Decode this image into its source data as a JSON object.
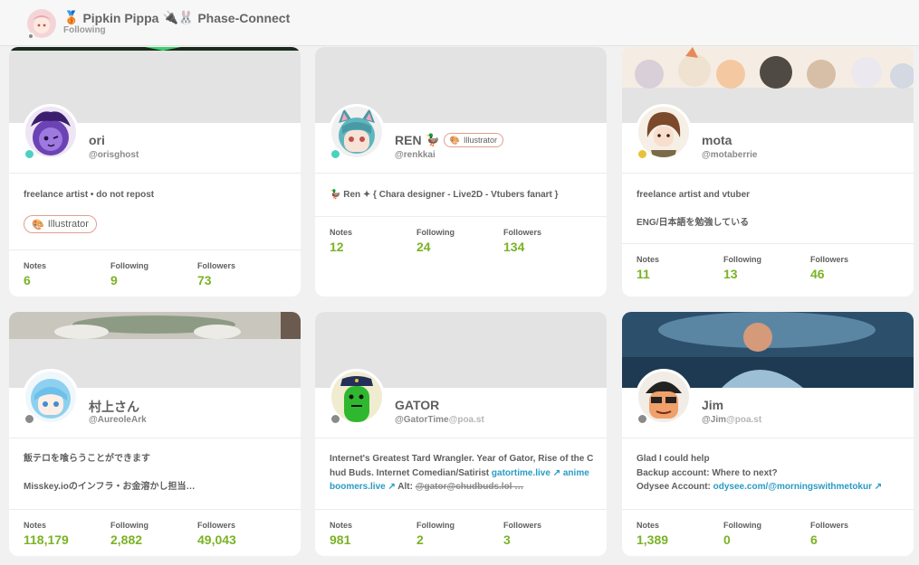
{
  "header": {
    "medal_emoji": "🥉",
    "title": "Pipkin Pippa",
    "title_emojis": "🔌🐰",
    "org": "Phase-Connect",
    "subtitle": "Following"
  },
  "stat_labels": {
    "notes": "Notes",
    "following": "Following",
    "followers": "Followers"
  },
  "cards": [
    {
      "name": "ori",
      "handle": "@orisghost",
      "host": "",
      "status_color": "#4dd0c0",
      "bio_line1": "freelance artist • do not repost",
      "badge_icon": "🎨",
      "badge": "Illustrator",
      "notes": "6",
      "following": "9",
      "followers": "73"
    },
    {
      "name": "REN",
      "name_emoji": "🦆",
      "handle": "@renkkai",
      "host": "",
      "status_color": "#4dd0c0",
      "badge_icon": "🎨",
      "badge": "Illustrator",
      "bio_line1": "🦆 Ren ✦ { Chara designer - Live2D - Vtubers fanart }",
      "notes": "12",
      "following": "24",
      "followers": "134"
    },
    {
      "name": "mota",
      "handle": "@motaberrie",
      "host": "",
      "status_color": "#e8c23a",
      "bio_line1": "freelance artist and vtuber",
      "bio_line2": "ENG/日本語を勉強している",
      "notes": "11",
      "following": "13",
      "followers": "46"
    },
    {
      "name": "村上さん",
      "handle": "@AureoleArk",
      "host": "",
      "status_color": "#8a8a8a",
      "bio_line1": "飯テロを喰らうことができます",
      "bio_line2": "Misskey.ioのインフラ・お金溶かし担当…",
      "notes": "118,179",
      "following": "2,882",
      "followers": "49,043"
    },
    {
      "name": "GATOR",
      "handle": "@GatorTime",
      "host": "@poa.st",
      "status_color": "#8a8a8a",
      "bio_text": "Internet's Greatest Tard Wrangler. Year of Gator, Rise of the Chud Buds. Internet Comedian/Satirist ",
      "bio_link1": "gatortime.live",
      "bio_link2": "animeboomers.live",
      "bio_alt": "Alt:",
      "bio_alt_handle": "@gator@chudbuds.lol …",
      "notes": "981",
      "following": "2",
      "followers": "3"
    },
    {
      "name": "Jim",
      "handle": "@Jim",
      "host": "@poa.st",
      "status_color": "#8a8a8a",
      "bio_line1": "Glad I could help",
      "bio_line2": "Backup account: Where to next?",
      "bio_line3_label": "Odysee Account:",
      "bio_link": "odysee.com/@morningswithmetokur",
      "notes": "1,389",
      "following": "0",
      "followers": "6"
    }
  ]
}
